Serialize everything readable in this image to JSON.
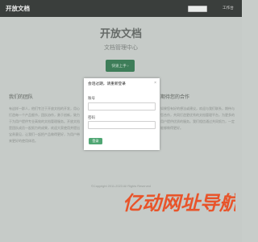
{
  "navbar": {
    "brand": "开放文档",
    "search_value": "",
    "link": "工作台"
  },
  "hero": {
    "title": "开放文档",
    "subtitle": "文档管理中心",
    "button": "快速上手 ›"
  },
  "sections": {
    "left": {
      "title": "我们的团队",
      "text": "有这样一群人，他们专注于开放文档的开发，用心打造每一个产品细节，团队协作，勇于创新，致力于为用户提供专业高效的文档管理服务。开放文档是团队成员一起努力的成果，欢迎大家使用并提出宝贵意见，让我们一起把产品做得更好，为用户带来更好的使用体验。"
    },
    "right": {
      "title": "期待您的合作",
      "text": "如果您有好的想法或建议，欢迎与我们联系，期待与您合作，共同打造更优秀的文档管理平台，为更多的用户提供优质的服务。我们相信通过共同努力，一定能够做得更好。"
    }
  },
  "footer": "©Copyright 2011-2023 All Rights Reserved",
  "watermark_text": "亿动网址导航",
  "modal": {
    "title": "会话过期，请重新登录",
    "close": "×",
    "username_label": "账号",
    "username_value": "",
    "password_label": "密码",
    "password_value": "",
    "login_button": "登录"
  },
  "colors": {
    "accent": "#3e7d59",
    "login": "#4fa673",
    "watermark": "#e8542a"
  }
}
